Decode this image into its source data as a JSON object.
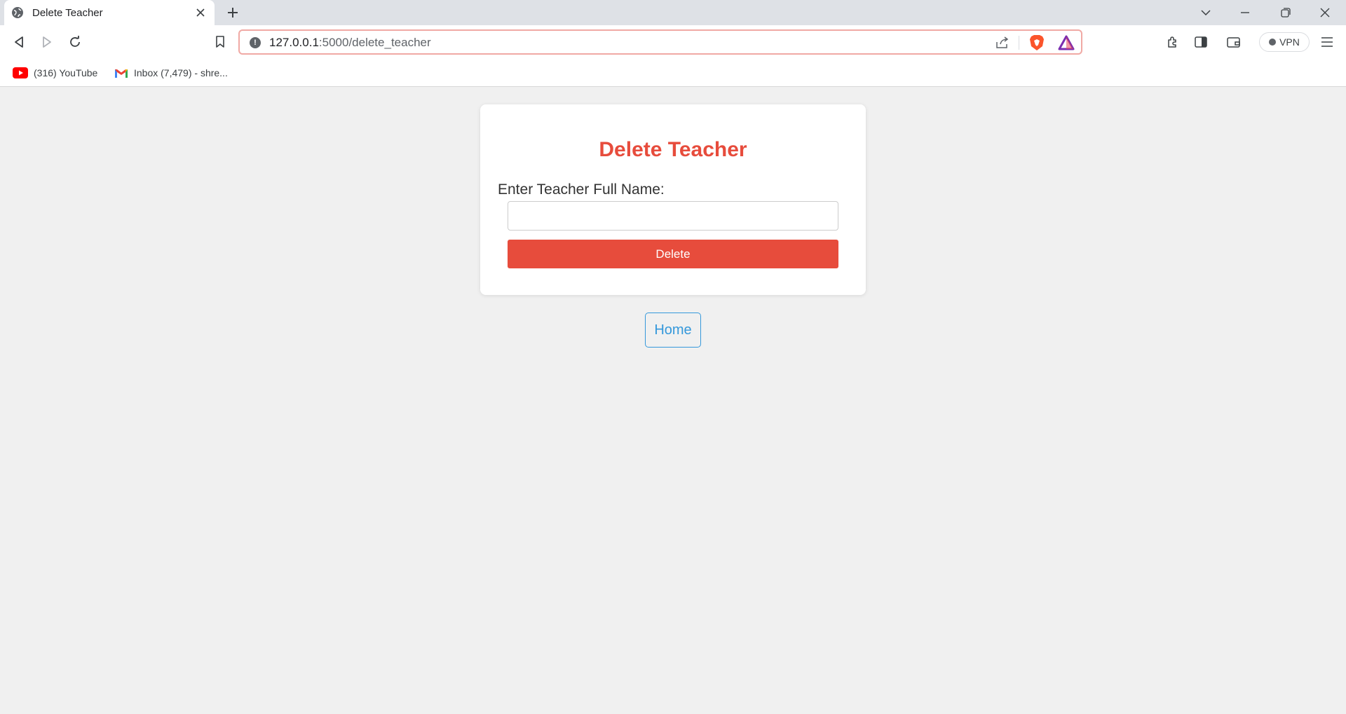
{
  "browser": {
    "tab": {
      "title": "Delete Teacher"
    },
    "address": {
      "host": "127.0.0.1",
      "path": ":5000/delete_teacher"
    },
    "vpn_label": "VPN",
    "bookmarks": [
      {
        "label": "(316) YouTube",
        "icon": "youtube-icon"
      },
      {
        "label": "Inbox (7,479) - shre...",
        "icon": "gmail-icon"
      }
    ]
  },
  "page": {
    "title": "Delete Teacher",
    "field_label": "Enter Teacher Full Name:",
    "name_value": "",
    "delete_label": "Delete",
    "home_label": "Home"
  },
  "colors": {
    "accent_red": "#e74c3c",
    "link_blue": "#3498db",
    "page_bg": "#f0f0f0"
  }
}
